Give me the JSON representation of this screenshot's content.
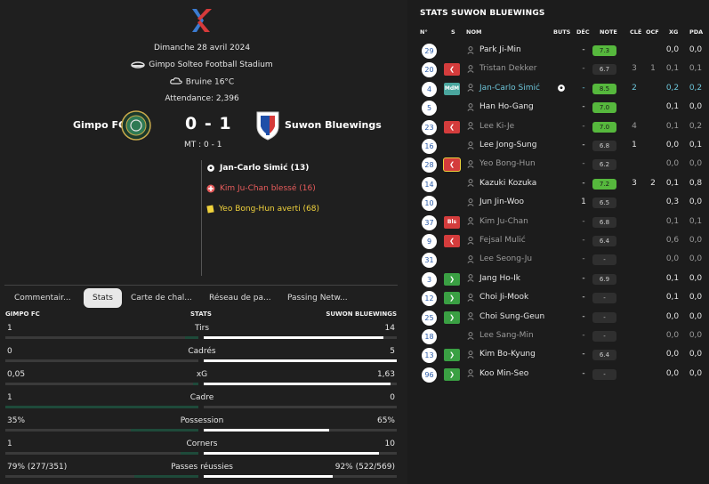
{
  "match": {
    "date": "Dimanche 28 avril 2024",
    "stadium": "Gimpo Solteo Football Stadium",
    "weather": "Bruine 16°C",
    "attendance": "Attendance: 2,396",
    "home_team": "Gimpo FC",
    "away_team": "Suwon Bluewings",
    "score": "0 - 1",
    "half_time": "MT : 0 - 1",
    "events": [
      {
        "type": "goal",
        "text": "Jan-Carlo Simić (13)",
        "icon": "football-icon"
      },
      {
        "type": "injury",
        "text": "Kim Ju-Chan blessé (16)",
        "icon": "injury-cross-icon"
      },
      {
        "type": "yellow",
        "text": "Yeo Bong-Hun averti (68)",
        "icon": "yellow-card-icon"
      }
    ]
  },
  "tabs": [
    {
      "label": "Commentair...",
      "active": false
    },
    {
      "label": "Stats",
      "active": true
    },
    {
      "label": "Carte de chal...",
      "active": false
    },
    {
      "label": "Réseau de pa...",
      "active": false
    },
    {
      "label": "Passing Netw...",
      "active": false
    }
  ],
  "stats": {
    "home_header": "GIMPO FC",
    "center_header": "STATS",
    "away_header": "SUWON BLUEWINGS",
    "rows": [
      {
        "label": "Tirs",
        "home": "1",
        "away": "14",
        "home_frac": 0.07,
        "away_frac": 0.93
      },
      {
        "label": "Cadrés",
        "home": "0",
        "away": "5",
        "home_frac": 0.0,
        "away_frac": 1.0
      },
      {
        "label": "xG",
        "home": "0,05",
        "away": "1,63",
        "home_frac": 0.03,
        "away_frac": 0.97
      },
      {
        "label": "Cadre",
        "home": "1",
        "away": "0",
        "home_frac": 1.0,
        "away_frac": 0.0
      },
      {
        "label": "Possession",
        "home": "35%",
        "away": "65%",
        "home_frac": 0.35,
        "away_frac": 0.65
      },
      {
        "label": "Corners",
        "home": "1",
        "away": "10",
        "home_frac": 0.09,
        "away_frac": 0.91
      },
      {
        "label": "Passes réussies",
        "home": "79% (277/351)",
        "away": "92% (522/569)",
        "home_frac": 0.33,
        "away_frac": 0.67
      }
    ]
  },
  "player_stats": {
    "title": "STATS SUWON BLUEWINGS",
    "columns": [
      "N°",
      "S",
      "NOM",
      "BUTS",
      "DÉC",
      "NOTE",
      "CLÉ",
      "OCF",
      "XG",
      "PDA"
    ],
    "players": [
      {
        "num": "29",
        "sub": "",
        "name": "Park Ji-Min",
        "dim": false,
        "goal": false,
        "dec": "-",
        "note": "7.3",
        "green": true,
        "cle": "",
        "ocf": "",
        "xg": "0,0",
        "pda": "0,0"
      },
      {
        "num": "20",
        "sub": "out",
        "name": "Tristan Dekker",
        "dim": true,
        "goal": false,
        "dec": "-",
        "note": "6.7",
        "green": false,
        "cle": "3",
        "ocf": "1",
        "xg": "0,1",
        "pda": "0,1"
      },
      {
        "num": "4",
        "sub": "mdm",
        "sub_label": "MdM",
        "name": "Jan-Carlo Simić",
        "dim": false,
        "hl": true,
        "goal": true,
        "dec": "-",
        "note": "8.5",
        "green": true,
        "cle": "2",
        "ocf": "",
        "xg": "0,2",
        "pda": "0,2"
      },
      {
        "num": "5",
        "sub": "",
        "name": "Han Ho-Gang",
        "dim": false,
        "goal": false,
        "dec": "-",
        "note": "7.0",
        "green": true,
        "cle": "",
        "ocf": "",
        "xg": "0,1",
        "pda": "0,0"
      },
      {
        "num": "23",
        "sub": "out",
        "name": "Lee Ki-Je",
        "dim": true,
        "goal": false,
        "dec": "-",
        "note": "7.0",
        "green": true,
        "cle": "4",
        "ocf": "",
        "xg": "0,1",
        "pda": "0,2"
      },
      {
        "num": "16",
        "sub": "",
        "name": "Lee Jong-Sung",
        "dim": false,
        "goal": false,
        "dec": "-",
        "note": "6.8",
        "green": false,
        "cle": "1",
        "ocf": "",
        "xg": "0,0",
        "pda": "0,1"
      },
      {
        "num": "28",
        "sub": "out-ring",
        "name": "Yeo Bong-Hun",
        "dim": true,
        "goal": false,
        "dec": "-",
        "note": "6.2",
        "green": false,
        "cle": "",
        "ocf": "",
        "xg": "0,0",
        "pda": "0,0"
      },
      {
        "num": "14",
        "sub": "",
        "name": "Kazuki Kozuka",
        "dim": false,
        "goal": false,
        "dec": "-",
        "note": "7.2",
        "green": true,
        "cle": "3",
        "ocf": "2",
        "xg": "0,1",
        "pda": "0,8"
      },
      {
        "num": "10",
        "sub": "",
        "name": "Jun Jin-Woo",
        "dim": false,
        "goal": false,
        "dec": "1",
        "note": "6.5",
        "green": false,
        "cle": "",
        "ocf": "",
        "xg": "0,3",
        "pda": "0,0"
      },
      {
        "num": "37",
        "sub": "bls",
        "sub_label": "Bls",
        "name": "Kim Ju-Chan",
        "dim": true,
        "goal": false,
        "dec": "-",
        "note": "6.8",
        "green": false,
        "cle": "",
        "ocf": "",
        "xg": "0,1",
        "pda": "0,1"
      },
      {
        "num": "9",
        "sub": "out",
        "name": "Fejsal Mulić",
        "dim": true,
        "goal": false,
        "dec": "-",
        "note": "6.4",
        "green": false,
        "cle": "",
        "ocf": "",
        "xg": "0,6",
        "pda": "0,0"
      },
      {
        "num": "31",
        "sub": "",
        "name": "Lee Seong-Ju",
        "dim": true,
        "goal": false,
        "dec": "-",
        "note": "-",
        "green": false,
        "cle": "",
        "ocf": "",
        "xg": "0,0",
        "pda": "0,0"
      },
      {
        "num": "3",
        "sub": "in",
        "name": "Jang Ho-Ik",
        "dim": false,
        "goal": false,
        "dec": "-",
        "note": "6.9",
        "green": false,
        "cle": "",
        "ocf": "",
        "xg": "0,1",
        "pda": "0,0"
      },
      {
        "num": "12",
        "sub": "in",
        "name": "Choi Ji-Mook",
        "dim": false,
        "goal": false,
        "dec": "-",
        "note": "-",
        "green": false,
        "cle": "",
        "ocf": "",
        "xg": "0,1",
        "pda": "0,0"
      },
      {
        "num": "25",
        "sub": "in",
        "name": "Choi Sung-Geun",
        "dim": false,
        "goal": false,
        "dec": "-",
        "note": "-",
        "green": false,
        "cle": "",
        "ocf": "",
        "xg": "0,0",
        "pda": "0,0"
      },
      {
        "num": "18",
        "sub": "",
        "name": "Lee Sang-Min",
        "dim": true,
        "goal": false,
        "dec": "-",
        "note": "-",
        "green": false,
        "cle": "",
        "ocf": "",
        "xg": "0,0",
        "pda": "0,0"
      },
      {
        "num": "13",
        "sub": "in",
        "name": "Kim Bo-Kyung",
        "dim": false,
        "goal": false,
        "dec": "-",
        "note": "6.4",
        "green": false,
        "cle": "",
        "ocf": "",
        "xg": "0,0",
        "pda": "0,0"
      },
      {
        "num": "96",
        "sub": "in",
        "name": "Koo Min-Seo",
        "dim": false,
        "goal": false,
        "dec": "-",
        "note": "-",
        "green": false,
        "cle": "",
        "ocf": "",
        "xg": "0,0",
        "pda": "0,0"
      }
    ]
  },
  "colors": {
    "rating_green": "#56b83d",
    "sub_out_red": "#d43c3c",
    "sub_in_green": "#3aa043",
    "highlight_cyan": "#6cc4d8",
    "home_bar": "#1e4a3a",
    "away_bar": "#ffffff"
  }
}
